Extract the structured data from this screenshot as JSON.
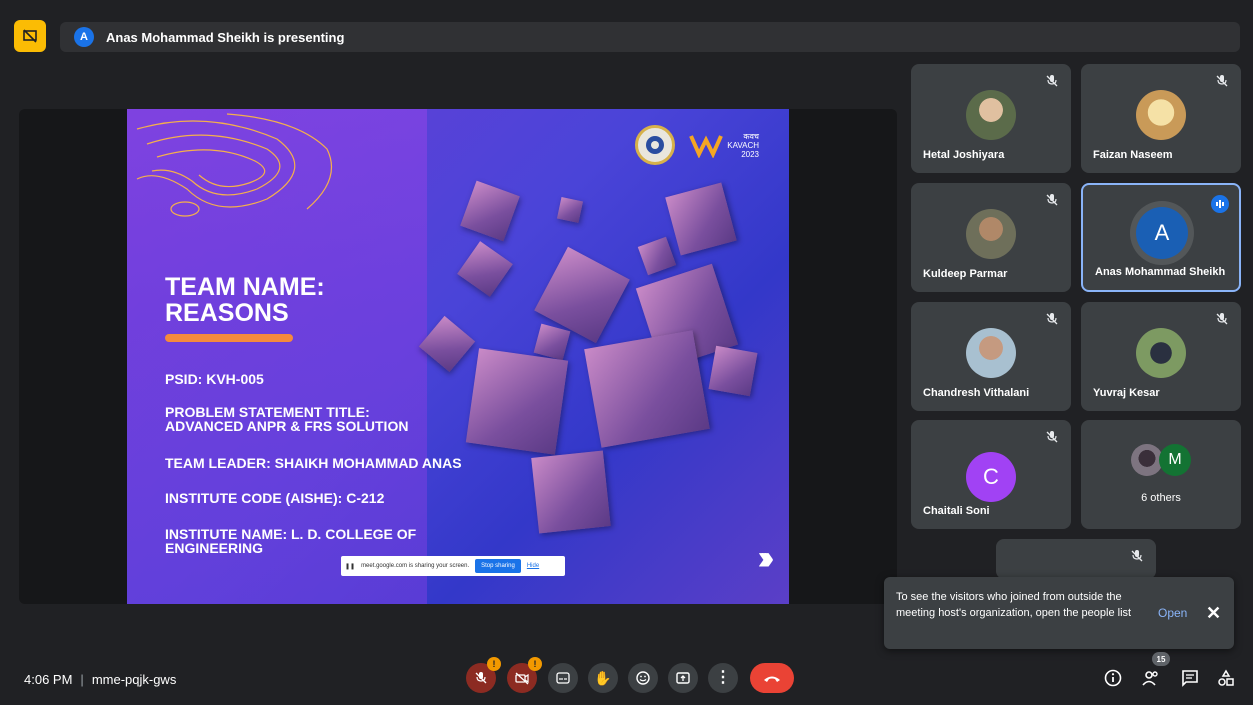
{
  "presenting": {
    "avatar_letter": "A",
    "text": "Anas Mohammad Sheikh is presenting"
  },
  "slide": {
    "team_name_line1": "TEAM NAME:",
    "team_name_line2": "REASONS",
    "psid": "PSID: KVH-005",
    "problem_line1": "PROBLEM STATEMENT TITLE:",
    "problem_line2": "ADVANCED ANPR & FRS SOLUTION",
    "leader": "TEAM LEADER: SHAIKH MOHAMMAD ANAS",
    "institute_code": "INSTITUTE CODE (AISHE): C-212",
    "institute_name_line1": "INSTITUTE NAME: L. D. COLLEGE OF",
    "institute_name_line2": "ENGINEERING",
    "kavach_line1": "कवच",
    "kavach_line2": "KAVACH",
    "kavach_line3": "2023",
    "share_text": "meet.google.com is sharing your screen.",
    "stop_sharing": "Stop sharing",
    "hide": "Hide",
    "next_glyph": "›››"
  },
  "participants": [
    {
      "name": "Hetal Joshiyara",
      "muted": true,
      "avatar_color": "#c8a27a"
    },
    {
      "name": "Faizan Naseem",
      "muted": true,
      "avatar_color": "#e8c97a"
    },
    {
      "name": "Kuldeep Parmar",
      "muted": true,
      "avatar_color": "#7d6a52"
    },
    {
      "name": "Anas Mohammad Sheikh",
      "letter": "A",
      "speaking": true,
      "avatar_color": "#1a5fb4"
    },
    {
      "name": "Chandresh Vithalani",
      "muted": true,
      "avatar_color": "#9fb8c8"
    },
    {
      "name": "Yuvraj Kesar",
      "muted": true,
      "avatar_color": "#6b8a5c"
    },
    {
      "name": "Chaitali Soni",
      "letter": "C",
      "muted": true,
      "avatar_color": "#a142f4"
    },
    {
      "name": "6 others",
      "letter": "M",
      "avatar_color": "#137333"
    }
  ],
  "toast": {
    "message": "To see the visitors who joined from outside the meeting host's organization, open the people list",
    "open": "Open",
    "close": "✕"
  },
  "bottom": {
    "time": "4:06 PM",
    "separator": "|",
    "meeting_code": "mme-pqjk-gws",
    "people_count": "15",
    "mic_badge": "!",
    "cam_badge": "!"
  }
}
